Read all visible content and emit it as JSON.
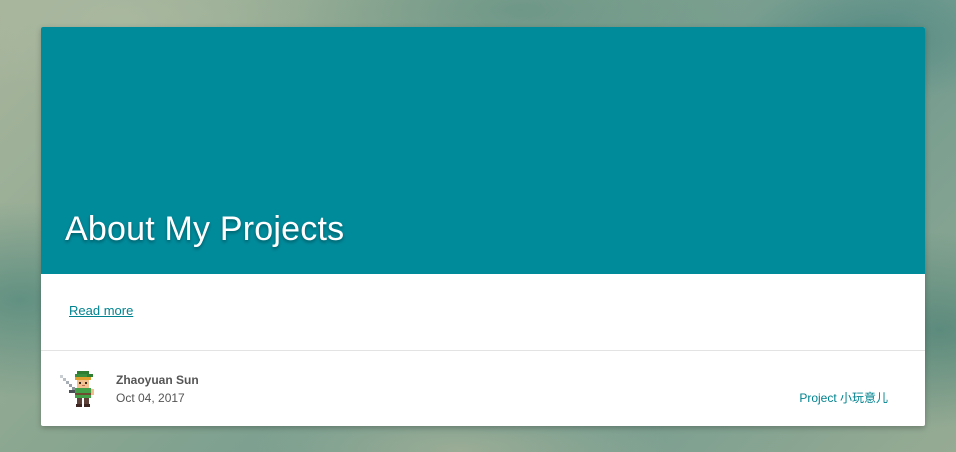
{
  "post": {
    "title": "About My Projects",
    "read_more_label": "Read more"
  },
  "author": {
    "name": "Zhaoyuan Sun",
    "date": "Oct 04, 2017"
  },
  "category": {
    "label": "Project 小玩意儿"
  },
  "colors": {
    "accent": "#008b9b",
    "link": "#00838f",
    "card": "#ffffff",
    "meta_text": "#555555"
  },
  "icons": {
    "avatar": "pixel-knight-avatar"
  }
}
